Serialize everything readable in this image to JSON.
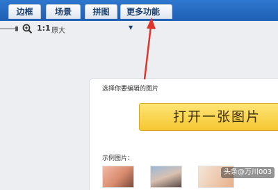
{
  "toolbar": {
    "tabs": [
      {
        "label": "边框"
      },
      {
        "label": "场景"
      },
      {
        "label": "拼图"
      },
      {
        "label": "更多功能"
      }
    ]
  },
  "zoom": {
    "ratio": "1:1",
    "original": "原大",
    "icon": "zoom-in-icon"
  },
  "panel": {
    "prompt": "选择你要编辑的图片",
    "open_button": "打开一张图片",
    "sample_label": "示例图片："
  },
  "watermark": "头条@万川003",
  "colors": {
    "toolbar_blue": "#1d5fb4",
    "button_yellow": "#f6c631",
    "arrow_red": "#e0342a"
  }
}
